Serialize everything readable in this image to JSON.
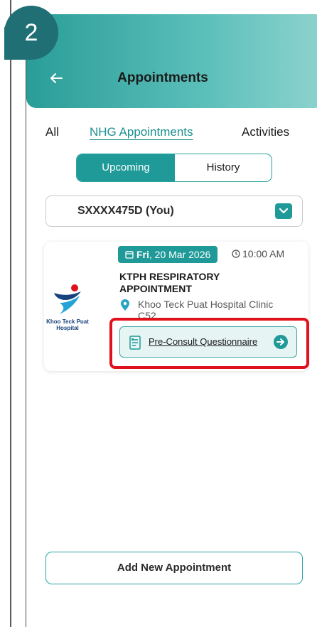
{
  "step": {
    "number": "2"
  },
  "header": {
    "title": "Appointments"
  },
  "tabs": [
    {
      "label": "All"
    },
    {
      "label": "NHG Appointments"
    },
    {
      "label": "Activities"
    }
  ],
  "segment": {
    "upcoming": "Upcoming",
    "history": "History"
  },
  "patient": {
    "selected": "SXXXX475D (You)"
  },
  "appointment": {
    "date_day": "Fri",
    "date_rest": ", 20 Mar 2026",
    "time": "10:00 AM",
    "title": "KTPH RESPIRATORY APPOINTMENT",
    "location": "Khoo Teck Puat Hospital Clinic C52",
    "logo_text": "Khoo Teck Puat Hospital",
    "questionnaire_label": "Pre-Consult Questionnaire"
  },
  "footer": {
    "add_label": "Add New Appointment"
  },
  "colors": {
    "brand": "#1f9a98",
    "highlight": "#e0101c",
    "logo_blue": "#17427d"
  }
}
